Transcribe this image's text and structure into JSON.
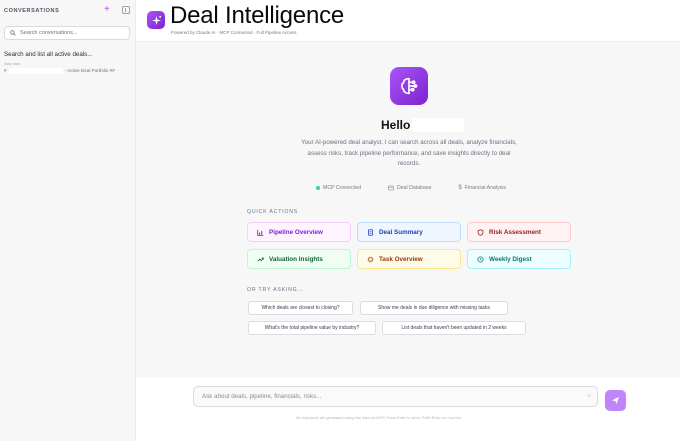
{
  "sidebar": {
    "title": "CONVERSATIONS",
    "new_icon": "plus-icon",
    "collapse_icon": "sidebar-collapse-icon",
    "search_placeholder": "Search conversations...",
    "conversations": [
      {
        "title": "Search and list all active deals...",
        "time": "Just now",
        "prefix": "#",
        "subtitle": "- Active Deal Portfolio ##"
      }
    ]
  },
  "header": {
    "title": "Deal Intelligence",
    "subtitle": "Powered by Claude AI · MCP Connected · Full Pipeline Access",
    "logo_icon": "sparkle-logo-icon"
  },
  "welcome": {
    "greeting": "Hello",
    "intro": "Your AI-powered deal analyst. I can search across all deals, analyze financials, assess risks, track pipeline performance, and save insights directly to deal records.",
    "status": [
      {
        "label": "MCP Connected",
        "icon": "green-dot-icon"
      },
      {
        "label": "Deal Database",
        "icon": "database-icon"
      },
      {
        "label": "Financial Analysis",
        "icon": "dollar-icon"
      }
    ]
  },
  "quick_actions": {
    "label": "QUICK ACTIONS",
    "items": [
      {
        "label": "Pipeline Overview",
        "icon": "bar-chart-icon",
        "color": "#7e22ce",
        "bg": "#fdf4ff",
        "border": "#f5d0fe"
      },
      {
        "label": "Deal Summary",
        "icon": "document-icon",
        "color": "#1e40af",
        "bg": "#eff6ff",
        "border": "#bfdbfe"
      },
      {
        "label": "Risk Assessment",
        "icon": "shield-icon",
        "color": "#991b1b",
        "bg": "#fef2f2",
        "border": "#fecaca"
      },
      {
        "label": "Valuation Insights",
        "icon": "trending-up-icon",
        "color": "#166534",
        "bg": "#f0fdf4",
        "border": "#bbf7d0"
      },
      {
        "label": "Task Overview",
        "icon": "target-icon",
        "color": "#9a3412",
        "bg": "#fefce8",
        "border": "#fde68a"
      },
      {
        "label": "Weekly Digest",
        "icon": "clock-icon",
        "color": "#0f766e",
        "bg": "#ecfeff",
        "border": "#a5f3fc"
      }
    ]
  },
  "suggestions": {
    "label": "OR TRY ASKING...",
    "items": [
      "Which deals are closest to closing?",
      "Show me deals in due diligence with missing tasks",
      "What's the total pipeline value by industry?",
      "List deals that haven't been updated in 2 weeks"
    ]
  },
  "composer": {
    "placeholder": "Ask about deals, pipeline, financials, risks...",
    "sparkle_icon": "sparkle-icon",
    "send_icon": "send-icon",
    "disclaimer": "All responses are generated using real data via MCP. Press Enter to send, Shift+Enter for new line."
  },
  "colors": {
    "brand": "#9333ea",
    "brand_light": "#c084fc"
  }
}
